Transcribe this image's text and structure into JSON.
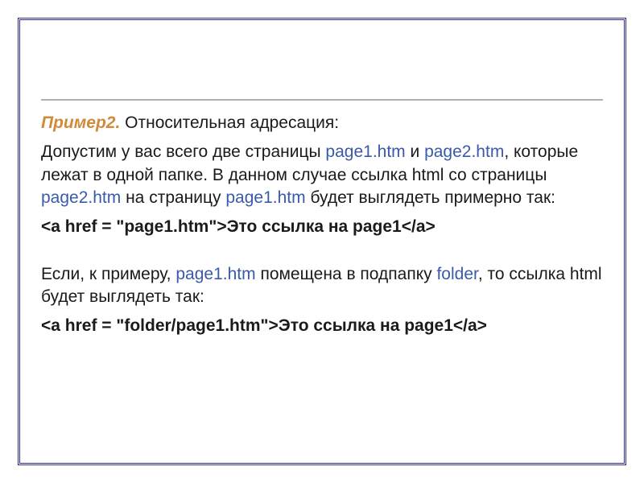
{
  "example": {
    "label": "Пример2.",
    "title_rest": " Относительная адресация:"
  },
  "para1": {
    "t1": "Допустим у вас всего две страницы ",
    "f1": "page1.htm",
    "t2": " и ",
    "f2": "page2.htm",
    "t3": ", которые лежат в одной папке. В данном случае ссылка html со страницы ",
    "f3": "page2.htm",
    "t4": " на страницу ",
    "f4": "page1.htm",
    "t5": " будет выглядеть примерно так:"
  },
  "code1": "<a href = \"page1.htm\">Это ссылка на page1</a>",
  "para2": {
    "t1": "Если, к примеру, ",
    "f1": "page1.htm",
    "t2": " помещена в подпапку ",
    "f2": "folder",
    "t3": ", то ссылка html будет выглядеть так:"
  },
  "code2": "<a href = \"folder/page1.htm\">Это ссылка на page1</a>"
}
